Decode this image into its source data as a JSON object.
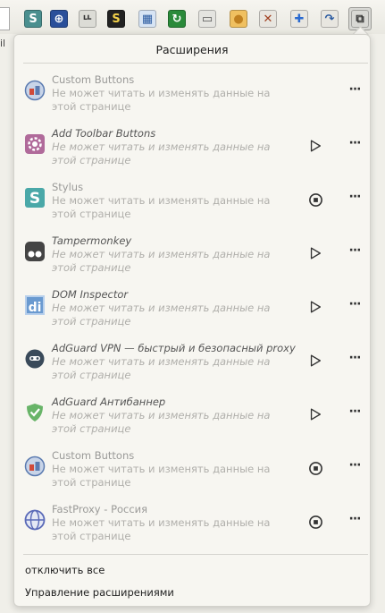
{
  "toolbar": {
    "side_text": "il",
    "buttons": [
      {
        "name": "stylus-toolbar-icon",
        "glyph": "S",
        "bg": "#4a8f8f",
        "fg": "#fff"
      },
      {
        "name": "globe-toolbar-icon",
        "glyph": "⊕",
        "bg": "#2a4f9a",
        "fg": "#fff"
      },
      {
        "name": "tree-toolbar-icon",
        "glyph": "ᄔ",
        "bg": "#dcdcd6",
        "fg": "#333"
      },
      {
        "name": "script-toolbar-icon",
        "glyph": "S",
        "bg": "#222",
        "fg": "#f4d24a"
      },
      {
        "name": "calendar-toolbar-icon",
        "glyph": "▦",
        "bg": "#d7e4f4",
        "fg": "#2a5aa0"
      },
      {
        "name": "refresh-toolbar-icon",
        "glyph": "↻",
        "bg": "#2a8a3a",
        "fg": "#fff"
      },
      {
        "name": "computer-toolbar-icon",
        "glyph": "▭",
        "bg": "#e4e4e0",
        "fg": "#555"
      },
      {
        "name": "coins-toolbar-icon",
        "glyph": "●",
        "bg": "#f0c060",
        "fg": "#c08020"
      },
      {
        "name": "tools-toolbar-icon",
        "glyph": "✕",
        "bg": "#e8e6e0",
        "fg": "#a04020"
      },
      {
        "name": "puzzle-blue-toolbar-icon",
        "glyph": "✚",
        "bg": "#e8e6e0",
        "fg": "#2a6ad0"
      },
      {
        "name": "arrow-toolbar-icon",
        "glyph": "↷",
        "bg": "#e8e6e0",
        "fg": "#2a5aa0"
      },
      {
        "name": "extensions-toolbar-icon",
        "glyph": "⧉",
        "bg": "#d8d8d4",
        "fg": "#333"
      }
    ]
  },
  "panel": {
    "title": "Расширения",
    "extensions": [
      {
        "name": "Custom Buttons",
        "desc": "Не может читать и изменять данные на этой странице",
        "italic": false,
        "action": "none",
        "icon": "custom-buttons-icon",
        "icon_color": "#5a7ab0"
      },
      {
        "name": "Add Toolbar Buttons",
        "desc": "Не может читать и изменять данные на этой странице",
        "italic": true,
        "action": "play",
        "icon": "gear-icon",
        "icon_color": "#b06a9a"
      },
      {
        "name": "Stylus",
        "desc": "Не может читать и изменять данные на этой странице",
        "italic": false,
        "action": "stop",
        "icon": "stylus-icon",
        "icon_color": "#4aa8a8"
      },
      {
        "name": "Tampermonkey",
        "desc": "Не может читать и изменять данные на этой странице",
        "italic": true,
        "action": "play",
        "icon": "tampermonkey-icon",
        "icon_color": "#444"
      },
      {
        "name": "DOM Inspector",
        "desc": "Не может читать и изменять данные на этой странице",
        "italic": true,
        "action": "play",
        "icon": "dom-inspector-icon",
        "icon_color": "#6a9ad0"
      },
      {
        "name": "AdGuard VPN — быстрый и безопасный proxy",
        "desc": "Не может читать и изменять данные на этой странице",
        "italic": true,
        "action": "play",
        "icon": "adguard-vpn-icon",
        "icon_color": "#3a4a5a"
      },
      {
        "name": "AdGuard Антибаннер",
        "desc": "Не может читать и изменять данные на этой странице",
        "italic": true,
        "action": "play",
        "icon": "adguard-shield-icon",
        "icon_color": "#68b468"
      },
      {
        "name": "Custom Buttons",
        "desc": "Не может читать и изменять данные на этой странице",
        "italic": false,
        "action": "stop",
        "icon": "custom-buttons-icon",
        "icon_color": "#5a7ab0"
      },
      {
        "name": "FastProxy - Россия",
        "desc": "Не может читать и изменять данные на этой странице",
        "italic": false,
        "action": "stop",
        "icon": "globe-icon",
        "icon_color": "#5a6ab8"
      }
    ],
    "disable_all": "отключить все",
    "manage": "Управление расширениями"
  }
}
